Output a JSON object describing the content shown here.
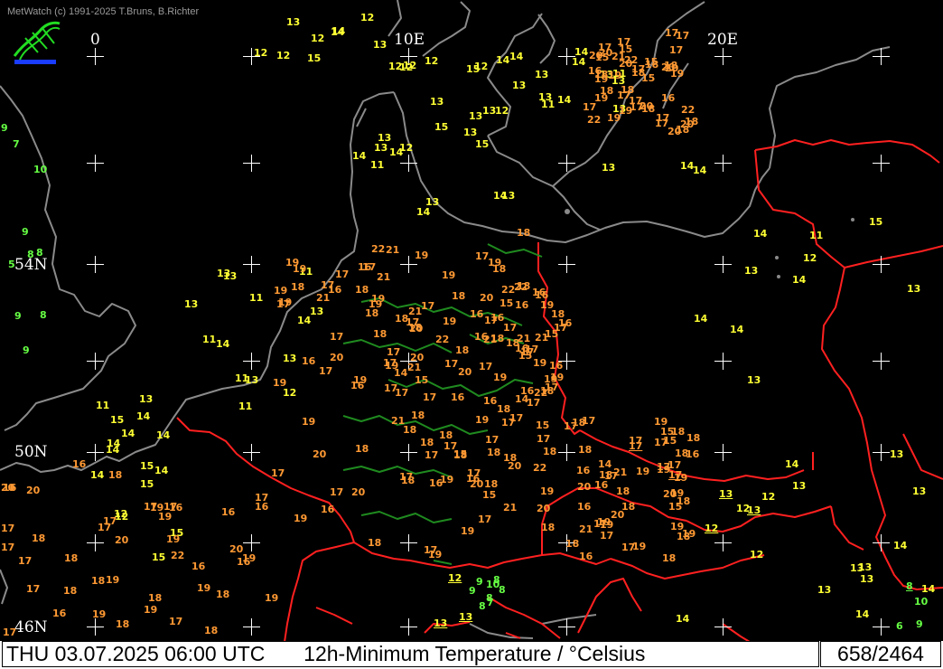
{
  "app": {
    "credit": "MetWatch  (c) 1991-2025 T.Bruns, B.Richter",
    "logo_icon": "metwatch-logo-icon"
  },
  "map": {
    "grid_labels": [
      "0",
      "10E",
      "20E",
      "54N",
      "50N",
      "46N"
    ],
    "colors": {
      "background": "#000000",
      "coast": "#8a8a8a",
      "border": "#ff2020",
      "region": "#1f8a1f"
    },
    "values": {
      "yellow": [
        "13",
        "12",
        "12",
        "11",
        "14",
        "13",
        "13",
        "13",
        "13",
        "14",
        "11",
        "13",
        "14",
        "13",
        "14",
        "12",
        "11",
        "13",
        "15",
        "11",
        "14",
        "11",
        "12",
        "13",
        "12",
        "15",
        "14",
        "13",
        "13",
        "14",
        "14",
        "14",
        "14",
        "15",
        "13",
        "12",
        "11",
        "13",
        "12",
        "15",
        "14",
        "14",
        "13",
        "12",
        "11",
        "14",
        "13",
        "13",
        "12",
        "13",
        "11",
        "12",
        "12",
        "12",
        "13",
        "15",
        "12",
        "14",
        "14",
        "15",
        "15",
        "13",
        "11",
        "12",
        "13",
        "13",
        "14",
        "14",
        "15",
        "14",
        "13",
        "14",
        "11",
        "13",
        "13",
        "14",
        "14",
        "13",
        "14",
        "13",
        "13",
        "12",
        "14",
        "14",
        "13",
        "13",
        "13",
        "14",
        "15",
        "14",
        "14",
        "14",
        "14",
        "14",
        "12",
        "12",
        "13",
        "14",
        "15",
        "13",
        "13",
        "13",
        "12"
      ],
      "orange": [
        "18",
        "16",
        "18",
        "16",
        "16",
        "16",
        "19",
        "16",
        "16",
        "19",
        "21",
        "18",
        "19",
        "17",
        "17",
        "18",
        "19",
        "15",
        "15",
        "15",
        "16",
        "16",
        "16",
        "17",
        "18",
        "18",
        "17",
        "18",
        "19",
        "17",
        "19",
        "17",
        "16",
        "17",
        "18",
        "18",
        "19",
        "20",
        "22",
        "19",
        "19",
        "20",
        "22",
        "21",
        "17",
        "16",
        "17",
        "18",
        "17",
        "19",
        "20",
        "20",
        "19",
        "18",
        "18",
        "17",
        "17",
        "19",
        "20",
        "18",
        "20",
        "22",
        "19",
        "16",
        "17",
        "18",
        "20",
        "21",
        "22",
        "17",
        "17",
        "19",
        "18",
        "19",
        "20",
        "21",
        "16",
        "18",
        "19",
        "20",
        "17",
        "18",
        "15",
        "15",
        "16",
        "16",
        "16",
        "17",
        "17",
        "18",
        "19",
        "17",
        "15",
        "16",
        "17",
        "17",
        "17",
        "19",
        "18",
        "18",
        "17",
        "21",
        "20",
        "19",
        "18",
        "16",
        "18",
        "17",
        "20",
        "18",
        "19",
        "18",
        "15",
        "16",
        "17",
        "18",
        "19",
        "20",
        "18",
        "19",
        "16",
        "17",
        "17",
        "19",
        "19",
        "19",
        "17",
        "19",
        "17",
        "20",
        "19",
        "18",
        "21",
        "19",
        "18",
        "18",
        "18",
        "16",
        "17",
        "18",
        "19",
        "22",
        "18",
        "20",
        "17",
        "18",
        "22",
        "17",
        "15",
        "14",
        "17",
        "18",
        "19",
        "20",
        "19",
        "15",
        "16",
        "17",
        "18",
        "16",
        "18",
        "17",
        "16",
        "17",
        "18",
        "19",
        "21",
        "17",
        "22",
        "19",
        "20",
        "17",
        "18",
        "17",
        "18",
        "18",
        "15",
        "17",
        "16",
        "18",
        "17",
        "19",
        "18",
        "16",
        "15",
        "17",
        "17",
        "16",
        "17",
        "18",
        "19",
        "18",
        "17",
        "22",
        "19",
        "18",
        "17",
        "19",
        "19",
        "17",
        "17",
        "18",
        "20",
        "17",
        "18",
        "20",
        "19",
        "22",
        "16",
        "17",
        "18",
        "15",
        "16",
        "17",
        "17",
        "18",
        "15",
        "17",
        "18",
        "17",
        "17",
        "16",
        "18",
        "17",
        "17",
        "17",
        "16",
        "19",
        "17",
        "17",
        "18",
        "19",
        "20",
        "16",
        "14",
        "17",
        "17",
        "18",
        "19",
        "19",
        "20",
        "20",
        "21",
        "18",
        "17",
        "18",
        "19",
        "20",
        "19",
        "18",
        "21",
        "17",
        "17",
        "22",
        "15",
        "14",
        "17",
        "19",
        "19",
        "21",
        "19",
        "20",
        "16",
        "17",
        "18",
        "19",
        "18",
        "21",
        "21",
        "21",
        "19",
        "20",
        "16",
        "17",
        "18",
        "20"
      ],
      "green": [
        "8",
        "8",
        "9",
        "9",
        "7",
        "8",
        "8",
        "10",
        "9",
        "8",
        "10",
        "8",
        "9",
        "7",
        "9",
        "10",
        "9",
        "6",
        "9",
        "8",
        "5"
      ],
      "underlined": [
        "13",
        "13",
        "12",
        "12",
        "17",
        "17",
        "13",
        "13",
        "8"
      ]
    }
  },
  "footer": {
    "datetime": "THU 03.07.2025 06:00 UTC",
    "title": "12h-Minimum Temperature / °Celsius",
    "count": "658/2464"
  }
}
